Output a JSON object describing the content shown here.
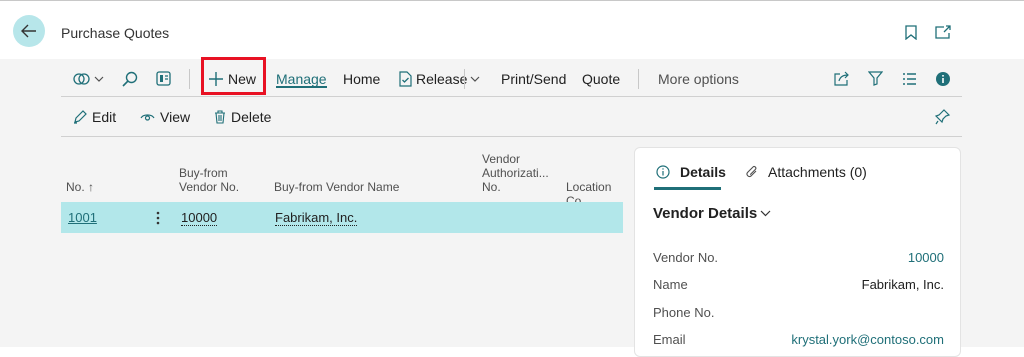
{
  "header": {
    "title": "Purchase Quotes"
  },
  "actions": {
    "new_label": "New",
    "manage_label": "Manage",
    "home_label": "Home",
    "release_label": "Release",
    "print_send_label": "Print/Send",
    "quote_label": "Quote",
    "more_options_label": "More options"
  },
  "subactions": {
    "edit_label": "Edit",
    "view_label": "View",
    "delete_label": "Delete"
  },
  "list": {
    "columns": {
      "no": "No.",
      "vendor_no_1": "Buy-from",
      "vendor_no_2": "Vendor No.",
      "vendor_name": "Buy-from Vendor Name",
      "auth_1": "Vendor",
      "auth_2": "Authorizati...",
      "auth_3": "No.",
      "location": "Location Co"
    },
    "rows": [
      {
        "no": "1001",
        "vendor_no": "10000",
        "vendor_name": "Fabrikam, Inc."
      }
    ]
  },
  "factbox": {
    "details_tab": "Details",
    "attachments_tab": "Attachments (0)",
    "section_title": "Vendor Details",
    "fields": [
      {
        "label": "Vendor No.",
        "value": "10000"
      },
      {
        "label": "Name",
        "value": "Fabrikam, Inc."
      },
      {
        "label": "Phone No.",
        "value": ""
      },
      {
        "label": "Email",
        "value": "krystal.york@contoso.com"
      }
    ]
  },
  "colors": {
    "accent": "#1f6f78",
    "selected_row": "#b2e7ea",
    "back_button": "#b7e6ea",
    "highlight_box": "#e81123"
  }
}
